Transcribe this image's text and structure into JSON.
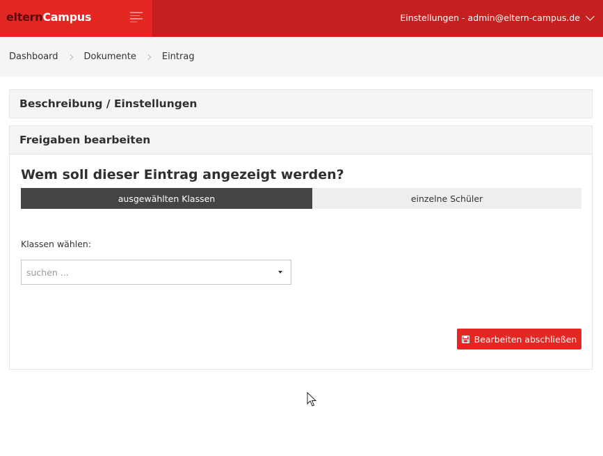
{
  "header": {
    "brand_part1": "eltern",
    "brand_part2": "Campus",
    "user_menu_label": "Einstellungen - admin@eltern-campus.de"
  },
  "breadcrumb": [
    "Dashboard",
    "Dokumente",
    "Eintrag"
  ],
  "panels": {
    "description_title": "Beschreibung / Einstellungen",
    "shares_title": "Freigaben bearbeiten"
  },
  "shares": {
    "question": "Wem soll dieser Eintrag angezeigt werden?",
    "segments": [
      {
        "label": "ausgewählten Klassen",
        "active": true
      },
      {
        "label": "einzelne Schüler",
        "active": false
      }
    ],
    "classes_label": "Klassen wählen:",
    "classes_placeholder": "suchen ..."
  },
  "actions": {
    "finish_label": "Bearbeiten abschließen"
  },
  "colors": {
    "brand_red": "#e52724",
    "header_red": "#c51f1f",
    "segment_active": "#444444"
  }
}
